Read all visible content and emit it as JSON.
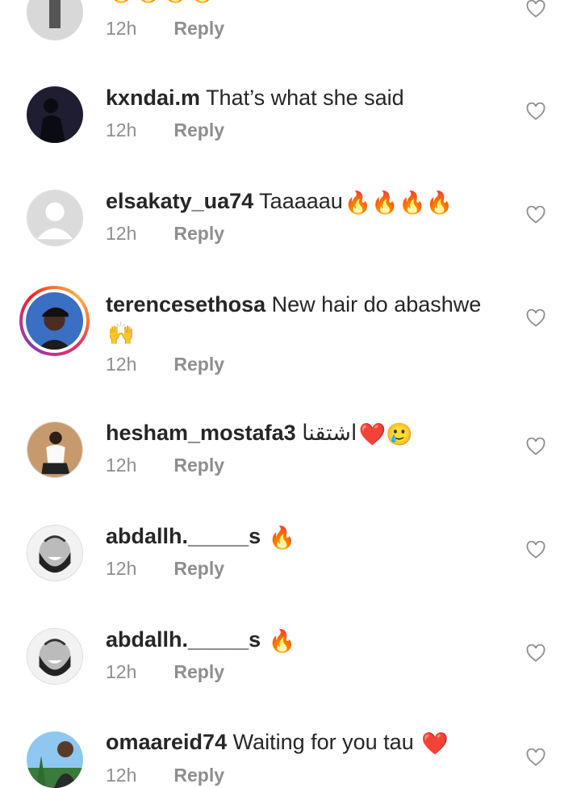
{
  "comments": [
    {
      "username": "",
      "text": "",
      "emoji": "🔥🔥🔥🔥",
      "time": "12h",
      "reply": "Reply"
    },
    {
      "username": "kxndai.m",
      "text": "That’s what she said",
      "emoji": "",
      "time": "12h",
      "reply": "Reply"
    },
    {
      "username": "elsakaty_ua74",
      "text": "Taaaaau",
      "emoji": "🔥🔥🔥🔥",
      "time": "12h",
      "reply": "Reply"
    },
    {
      "username": "terencesethosa",
      "text": "New hair do abashwe",
      "emoji": "🙌",
      "time": "12h",
      "reply": "Reply"
    },
    {
      "username": "hesham_mostafa3",
      "text": "اشتقنا",
      "emoji": "❤️🥲",
      "time": "12h",
      "reply": "Reply"
    },
    {
      "username": "abdallh._____s",
      "text": "",
      "emoji": "🔥",
      "time": "12h",
      "reply": "Reply"
    },
    {
      "username": "abdallh._____s",
      "text": "",
      "emoji": "🔥",
      "time": "12h",
      "reply": "Reply"
    },
    {
      "username": "omaareid74",
      "text": "Waiting for you tau",
      "emoji": "❤️",
      "time": "12h",
      "reply": "Reply"
    }
  ],
  "icons": {
    "like": "heart-outline-icon"
  },
  "colors": {
    "muted": "#8e8e8e",
    "text": "#262626"
  }
}
